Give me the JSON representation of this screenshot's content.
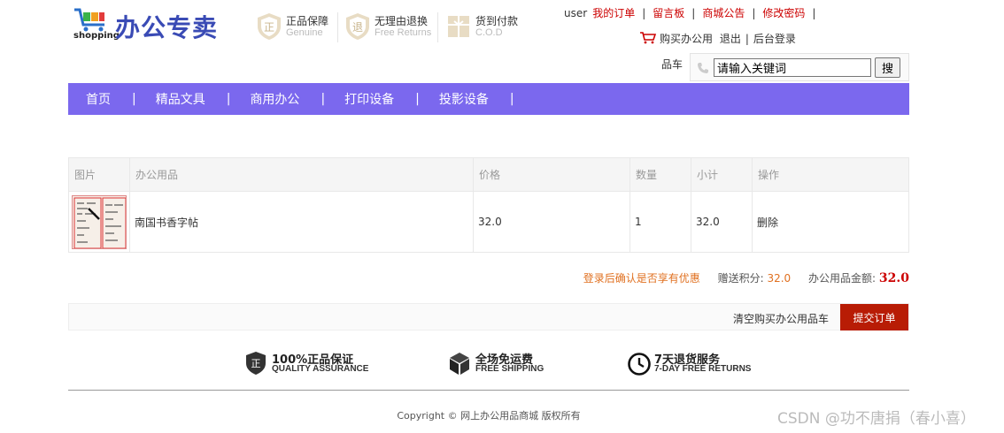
{
  "header": {
    "logo_sub": "shopping",
    "logo_title": "办公专卖",
    "badges": [
      {
        "title": "正品保障",
        "sub": "Genuine",
        "icon": "genuine-shield-icon",
        "glyph": "正"
      },
      {
        "title": "无理由退换",
        "sub": "Free Returns",
        "icon": "return-shield-icon",
        "glyph": "退"
      },
      {
        "title": "货到付款",
        "sub": "C.O.D",
        "icon": "cod-box-icon",
        "glyph": ""
      }
    ],
    "toplinks": {
      "user": "user",
      "orders": "我的订单",
      "messages": "留言板",
      "notice": "商城公告",
      "password": "修改密码"
    },
    "cart_line": {
      "cart": "购买办公用",
      "logout": "退出",
      "admin": "后台登录"
    },
    "search": {
      "label": "品车",
      "value": "请输入关键词",
      "button": "搜"
    }
  },
  "nav": {
    "items": [
      "首页",
      "精品文具",
      "商用办公",
      "打印设备",
      "投影设备"
    ]
  },
  "table": {
    "headers": [
      "图片",
      "办公用品",
      "价格",
      "数量",
      "小计",
      "操作"
    ],
    "rows": [
      {
        "name": "南国书香字帖",
        "price": "32.0",
        "qty": "1",
        "subtotal": "32.0",
        "action": "删除"
      }
    ]
  },
  "summary": {
    "promo": "登录后确认是否享有优惠",
    "points_label": "赠送积分:",
    "points": "32.0",
    "total_label": "办公用品金额:",
    "total": "32.0"
  },
  "actions": {
    "clear": "清空购买办公用品车",
    "submit": "提交订单"
  },
  "services": [
    {
      "title": "100%正品保证",
      "sub": "QUALITY ASSURANCE",
      "icon": "shield-icon"
    },
    {
      "title": "全场免运费",
      "sub": "FREE SHIPPING",
      "icon": "package-icon"
    },
    {
      "title": "7天退货服务",
      "sub": "7-DAY FREE RETURNS",
      "icon": "clock-icon"
    }
  ],
  "footer": {
    "copyright": "Copyright © 网上办公用品商城 版权所有",
    "watermark": "CSDN @功不唐捐（春小喜）"
  },
  "colors": {
    "nav_bg": "#7b68ee",
    "link_red": "#cc0000",
    "submit_bg": "#b81c05",
    "logo_blue": "#3a4bb5"
  }
}
